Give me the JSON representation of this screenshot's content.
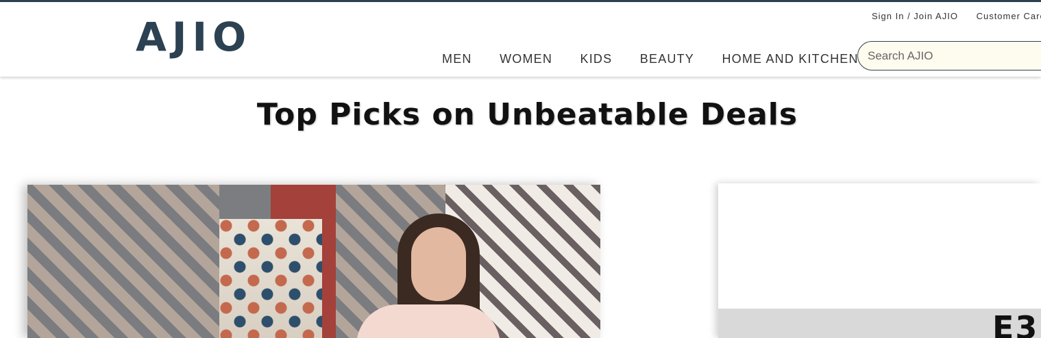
{
  "header": {
    "logo": "AJIO",
    "top_links": [
      "Sign In / Join AJIO",
      "Customer Care"
    ],
    "nav": [
      "MEN",
      "WOMEN",
      "KIDS",
      "BEAUTY",
      "HOME AND KITCHEN"
    ],
    "search_placeholder": "Search AJIO"
  },
  "main": {
    "headline": "Top Picks on Unbeatable Deals",
    "right_banner_text": "E3"
  },
  "colors": {
    "brand": "#2c4152",
    "search_bg": "#fefcef"
  }
}
